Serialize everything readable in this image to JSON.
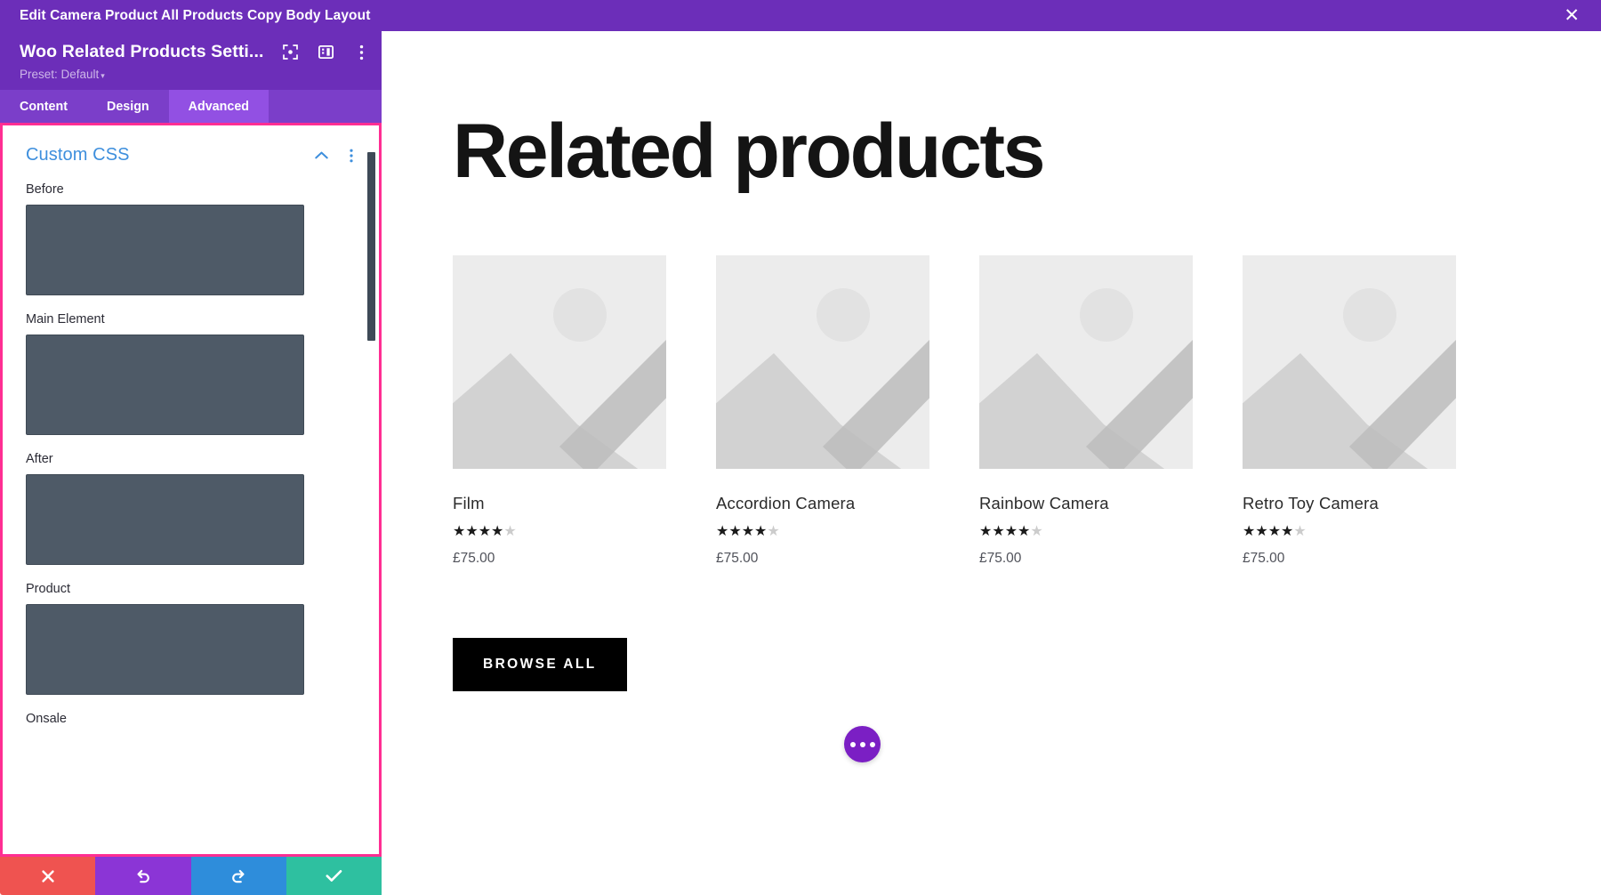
{
  "topbar": {
    "title": "Edit Camera Product All Products Copy Body Layout",
    "close_icon": "close-icon",
    "close_glyph": "✕"
  },
  "panel": {
    "title": "Woo Related Products Setti...",
    "preset_label": "Preset: Default",
    "preset_caret": "▾",
    "header_icons": [
      {
        "name": "focus-target-icon"
      },
      {
        "name": "layout-panel-icon"
      },
      {
        "name": "kebab-menu-icon"
      }
    ],
    "tabs": [
      {
        "label": "Content",
        "active": false
      },
      {
        "label": "Design",
        "active": false
      },
      {
        "label": "Advanced",
        "active": true
      }
    ],
    "section": {
      "title": "Custom CSS",
      "collapse_icon": "chevron-up-icon",
      "menu_icon": "kebab-menu-icon"
    },
    "fields": [
      {
        "label": "Before",
        "value": ""
      },
      {
        "label": "Main Element",
        "value": ""
      },
      {
        "label": "After",
        "value": ""
      },
      {
        "label": "Product",
        "value": ""
      },
      {
        "label": "Onsale",
        "value": ""
      }
    ],
    "footer": [
      {
        "name": "cancel-button",
        "glyph": "✕",
        "color": "#ef5350"
      },
      {
        "name": "undo-button",
        "glyph": "↺",
        "color": "#8b35d6"
      },
      {
        "name": "redo-button",
        "glyph": "↻",
        "color": "#2e8ddb"
      },
      {
        "name": "save-button",
        "glyph": "✓",
        "color": "#2ec0a0"
      }
    ]
  },
  "preview": {
    "heading": "Related products",
    "products": [
      {
        "name": "Film",
        "price": "£75.00",
        "rating": 4,
        "max_rating": 5
      },
      {
        "name": "Accordion Camera",
        "price": "£75.00",
        "rating": 4,
        "max_rating": 5
      },
      {
        "name": "Rainbow Camera",
        "price": "£75.00",
        "rating": 4,
        "max_rating": 5
      },
      {
        "name": "Retro Toy Camera",
        "price": "£75.00",
        "rating": 4,
        "max_rating": 5
      }
    ],
    "browse_all_label": "BROWSE ALL",
    "fab_icon": "ellipsis-icon"
  },
  "colors": {
    "brand_purple": "#6c2eb9",
    "tab_purple": "#7b3ec9",
    "tab_active_purple": "#9250e3",
    "highlight_pink": "#ff2e93",
    "link_blue": "#3e8fdd",
    "textarea_slate": "#4e5a67"
  }
}
